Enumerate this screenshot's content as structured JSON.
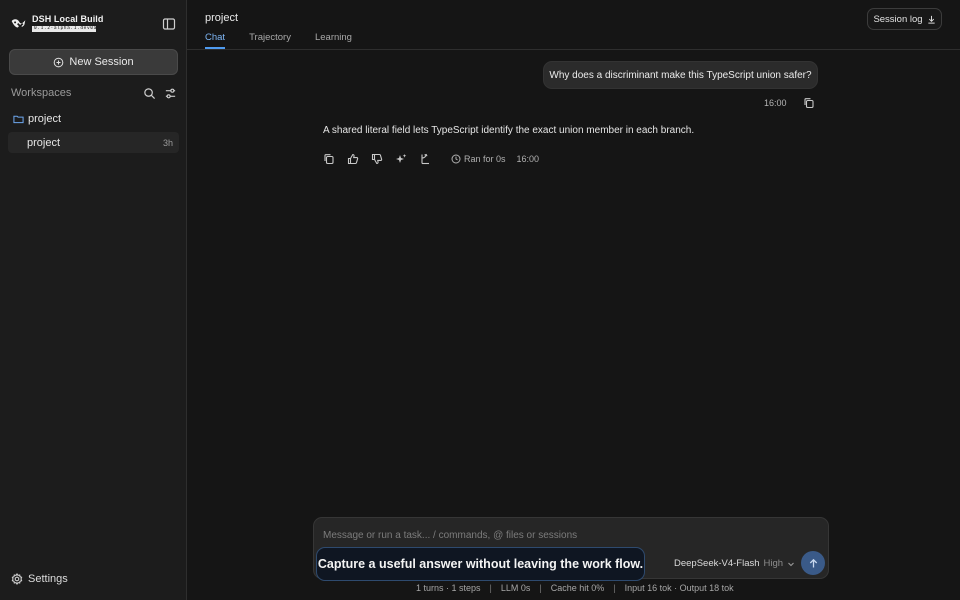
{
  "brand": {
    "title": "DSH Local Build",
    "version": "0.1.2-alpha.1.dev0a03"
  },
  "sidebar": {
    "new_session_label": "New Session",
    "workspaces_label": "Workspaces",
    "workspace": {
      "name": "project"
    },
    "session": {
      "name": "project",
      "age": "3h"
    },
    "settings_label": "Settings"
  },
  "header": {
    "title": "project",
    "tabs": [
      {
        "label": "Chat",
        "active": true
      },
      {
        "label": "Trajectory",
        "active": false
      },
      {
        "label": "Learning",
        "active": false
      }
    ],
    "session_log_label": "Session log"
  },
  "conversation": {
    "user_message": "Why does a discriminant make this TypeScript union safer?",
    "user_time": "16:00",
    "assistant_message": "A shared literal field lets TypeScript identify the exact union member in each branch.",
    "ran_for": "Ran for 0s",
    "assistant_time": "16:00"
  },
  "composer": {
    "placeholder": "Message or run a task... / commands, @ files or sessions",
    "model": "DeepSeek-V4-Flash",
    "effort": "High"
  },
  "tooltip": "Capture a useful answer without leaving the work flow.",
  "status": {
    "turns": "1 turns · 1 steps",
    "llm": "LLM 0s",
    "cache": "Cache hit 0%",
    "tokens": "Input 16 tok · Output 18 tok"
  },
  "colors": {
    "accent": "#4f9bf0",
    "send_button": "#3a5a88",
    "background": "#151515"
  }
}
